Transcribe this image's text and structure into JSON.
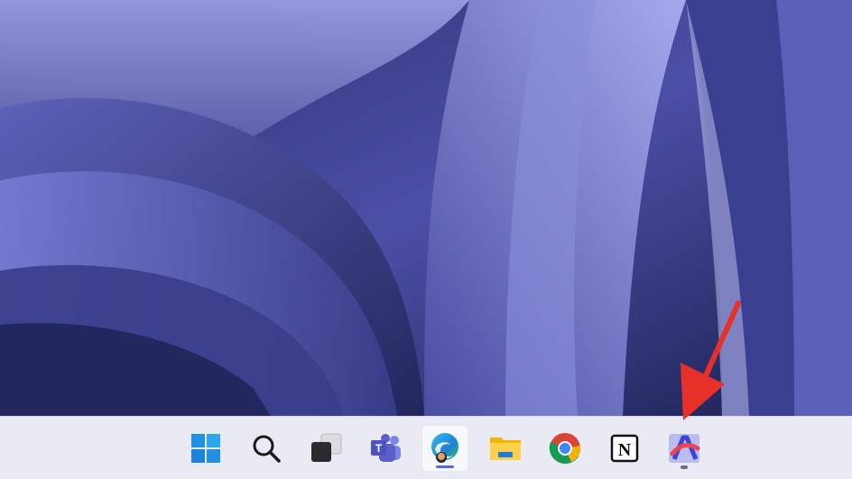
{
  "desktop": {
    "wallpaper": "windows-11-bloom-purple",
    "accent": "#5b5bc0"
  },
  "taskbar": {
    "items": [
      {
        "name": "start-button",
        "icon": "windows-logo-icon",
        "active": false
      },
      {
        "name": "search-button",
        "icon": "search-icon",
        "active": false
      },
      {
        "name": "task-view-button",
        "icon": "task-view-icon",
        "active": false
      },
      {
        "name": "teams-button",
        "icon": "teams-icon",
        "active": false
      },
      {
        "name": "edge-button",
        "icon": "edge-icon",
        "active": true
      },
      {
        "name": "file-explorer-button",
        "icon": "folder-icon",
        "active": false
      },
      {
        "name": "chrome-button",
        "icon": "chrome-icon",
        "active": false
      },
      {
        "name": "notion-button",
        "icon": "notion-icon",
        "active": false
      },
      {
        "name": "arc-button",
        "icon": "arc-icon",
        "active": false,
        "running": true
      }
    ],
    "colors": {
      "active_indicator": "#5b6bd6",
      "background": "#e9eaf3"
    }
  },
  "annotation": {
    "type": "red-arrow",
    "color": "#e8302a",
    "points_to": "arc-button"
  },
  "teams_letter": "T",
  "notion_letter": "N"
}
